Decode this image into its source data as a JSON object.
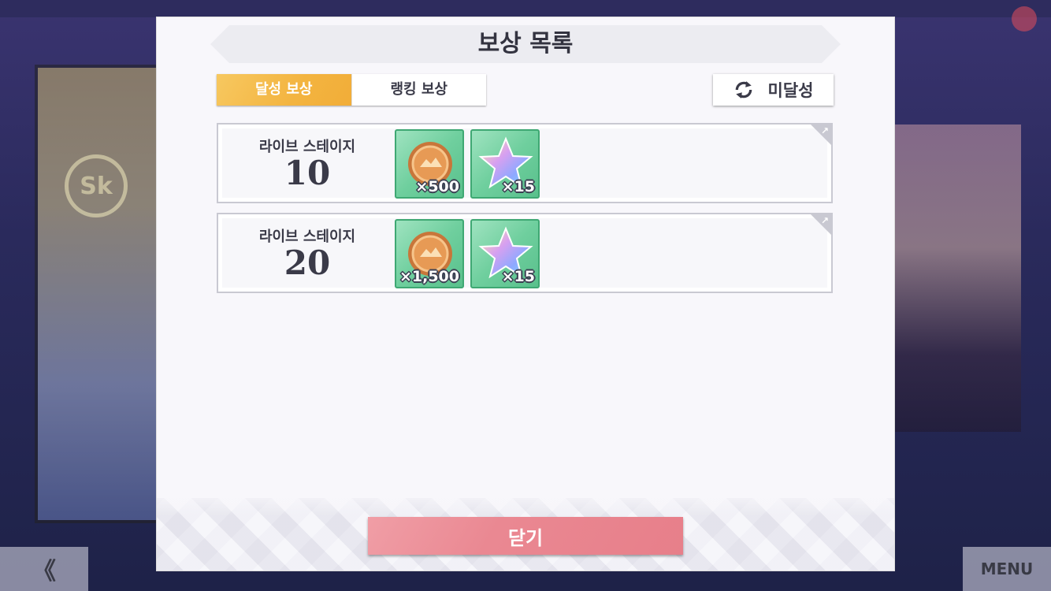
{
  "dialog": {
    "title": "보상 목록",
    "tabs": [
      {
        "label": "달성 보상",
        "active": true
      },
      {
        "label": "랭킹 보상",
        "active": false
      }
    ],
    "filter_button": {
      "label": "미달성",
      "icon": "sync-icon"
    },
    "rewards": [
      {
        "label": "라이브 스테이지",
        "value": "10",
        "items": [
          {
            "icon": "coin-icon",
            "quantity": "×500"
          },
          {
            "icon": "star-gem-icon",
            "quantity": "×15"
          }
        ]
      },
      {
        "label": "라이브 스테이지",
        "value": "20",
        "items": [
          {
            "icon": "coin-icon",
            "quantity": "×1,500"
          },
          {
            "icon": "star-gem-icon",
            "quantity": "×15"
          }
        ]
      }
    ],
    "close_button": "닫기"
  },
  "background": {
    "back_button": "《",
    "menu_button": "MENU"
  },
  "colors": {
    "active_tab": "#f3b440",
    "item_frame": "#6fcf9e",
    "close_button": "#ea8892"
  }
}
